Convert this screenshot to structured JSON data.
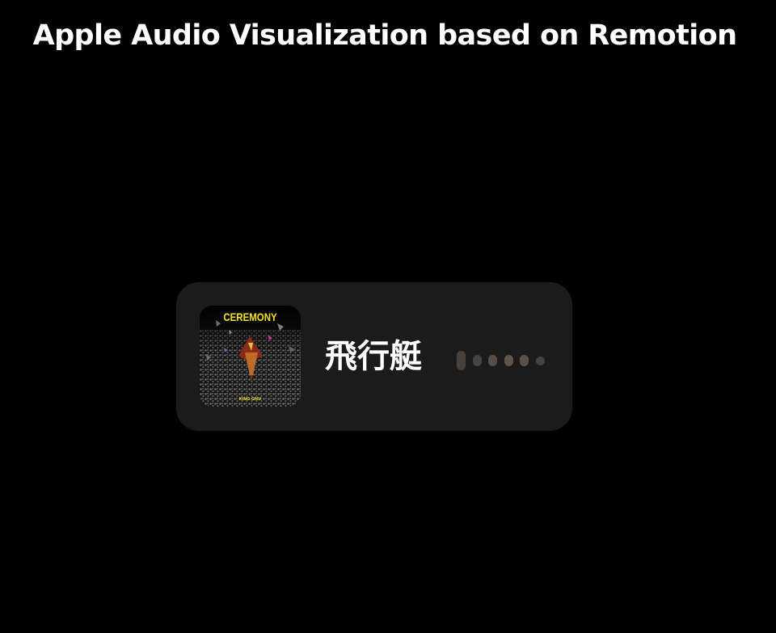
{
  "page": {
    "title": "Apple Audio Visualization based on Remotion"
  },
  "player": {
    "track_title": "飛行艇",
    "album": {
      "title": "CEREMONY",
      "credit": "KING GNU"
    }
  },
  "visualizer": {
    "bar_color": "#6b5f55",
    "levels": [
      1.0,
      0.55,
      0.55,
      0.55,
      0.55,
      0.45
    ],
    "opacities": [
      0.55,
      0.6,
      0.75,
      0.85,
      0.8,
      0.55
    ]
  },
  "colors": {
    "background": "#000000",
    "card": "#1b1b1b",
    "title_text": "#ffffff",
    "album_accent": "#f2e21b"
  }
}
